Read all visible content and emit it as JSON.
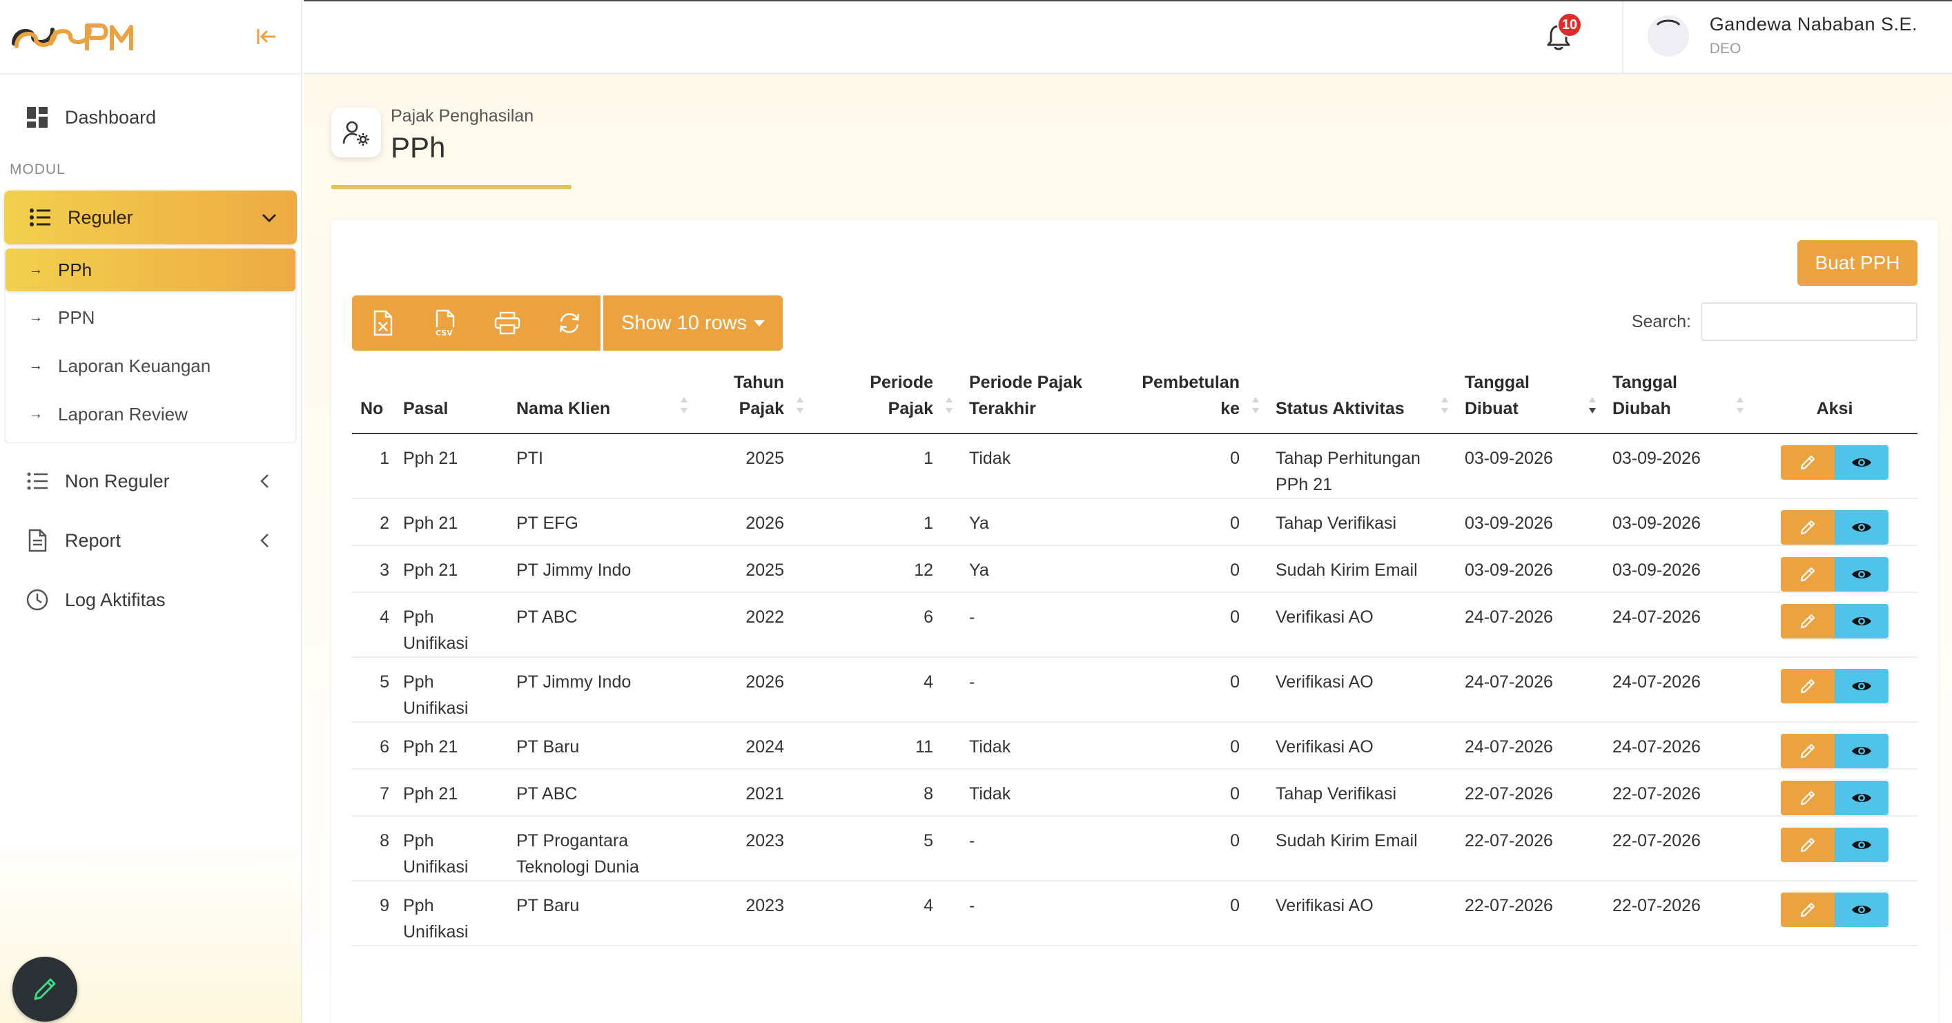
{
  "brand": {
    "logo_text": "SSPM"
  },
  "sidebar": {
    "dashboard_label": "Dashboard",
    "section_label": "MODUL",
    "reguler": {
      "label": "Reguler",
      "items": [
        {
          "label": "PPh",
          "active": true
        },
        {
          "label": "PPN"
        },
        {
          "label": "Laporan Keuangan"
        },
        {
          "label": "Laporan Review"
        }
      ]
    },
    "non_reguler_label": "Non Reguler",
    "report_label": "Report",
    "log_label": "Log Aktifitas"
  },
  "topbar": {
    "notification_count": "10",
    "user_name": "Gandewa Nababan S.E.",
    "user_role": "DEO"
  },
  "page": {
    "subtitle": "Pajak Penghasilan",
    "title": "PPh",
    "create_button": "Buat PPH",
    "show_rows": "Show 10 rows",
    "search_label": "Search:",
    "search_value": ""
  },
  "table": {
    "headers": {
      "no": "No",
      "pasal": "Pasal",
      "klien": "Nama Klien",
      "tahun_1": "Tahun",
      "tahun_2": "Pajak",
      "periode_1": "Periode",
      "periode_2": "Pajak",
      "terakhir_1": "Periode Pajak",
      "terakhir_2": "Terakhir",
      "pembetulan_1": "Pembetulan",
      "pembetulan_2": "ke",
      "status": "Status Aktivitas",
      "dibuat_1": "Tanggal",
      "dibuat_2": "Dibuat",
      "diubah_1": "Tanggal",
      "diubah_2": "Diubah",
      "aksi": "Aksi"
    },
    "rows": [
      {
        "no": "1",
        "pasal": "Pph 21",
        "klien": "PTI",
        "tahun": "2025",
        "periode": "1",
        "terakhir": "Tidak",
        "pembetulan": "0",
        "status": "Tahap Perhitungan PPh 21",
        "dibuat": "03-09-2026",
        "diubah": "03-09-2026"
      },
      {
        "no": "2",
        "pasal": "Pph 21",
        "klien": "PT EFG",
        "tahun": "2026",
        "periode": "1",
        "terakhir": "Ya",
        "pembetulan": "0",
        "status": "Tahap Verifikasi",
        "dibuat": "03-09-2026",
        "diubah": "03-09-2026"
      },
      {
        "no": "3",
        "pasal": "Pph 21",
        "klien": "PT Jimmy Indo",
        "tahun": "2025",
        "periode": "12",
        "terakhir": "Ya",
        "pembetulan": "0",
        "status": "Sudah Kirim Email",
        "dibuat": "03-09-2026",
        "diubah": "03-09-2026"
      },
      {
        "no": "4",
        "pasal": "Pph Unifikasi",
        "klien": "PT ABC",
        "tahun": "2022",
        "periode": "6",
        "terakhir": "-",
        "pembetulan": "0",
        "status": "Verifikasi AO",
        "dibuat": "24-07-2026",
        "diubah": "24-07-2026"
      },
      {
        "no": "5",
        "pasal": "Pph Unifikasi",
        "klien": "PT Jimmy Indo",
        "tahun": "2026",
        "periode": "4",
        "terakhir": "-",
        "pembetulan": "0",
        "status": "Verifikasi AO",
        "dibuat": "24-07-2026",
        "diubah": "24-07-2026"
      },
      {
        "no": "6",
        "pasal": "Pph 21",
        "klien": "PT Baru",
        "tahun": "2024",
        "periode": "11",
        "terakhir": "Tidak",
        "pembetulan": "0",
        "status": "Verifikasi AO",
        "dibuat": "24-07-2026",
        "diubah": "24-07-2026"
      },
      {
        "no": "7",
        "pasal": "Pph 21",
        "klien": "PT ABC",
        "tahun": "2021",
        "periode": "8",
        "terakhir": "Tidak",
        "pembetulan": "0",
        "status": "Tahap Verifikasi",
        "dibuat": "22-07-2026",
        "diubah": "22-07-2026"
      },
      {
        "no": "8",
        "pasal": "Pph Unifikasi",
        "klien": "PT Progantara Teknologi Dunia",
        "tahun": "2023",
        "periode": "5",
        "terakhir": "-",
        "pembetulan": "0",
        "status": "Sudah Kirim Email",
        "dibuat": "22-07-2026",
        "diubah": "22-07-2026"
      },
      {
        "no": "9",
        "pasal": "Pph Unifikasi",
        "klien": "PT Baru",
        "tahun": "2023",
        "periode": "4",
        "terakhir": "-",
        "pembetulan": "0",
        "status": "Verifikasi AO",
        "dibuat": "22-07-2026",
        "diubah": "22-07-2026"
      }
    ]
  },
  "colors": {
    "accent": "#eca23e",
    "view": "#4fc3ea",
    "active_gradient_start": "#f2d04c",
    "badge": "#e02b2b"
  }
}
